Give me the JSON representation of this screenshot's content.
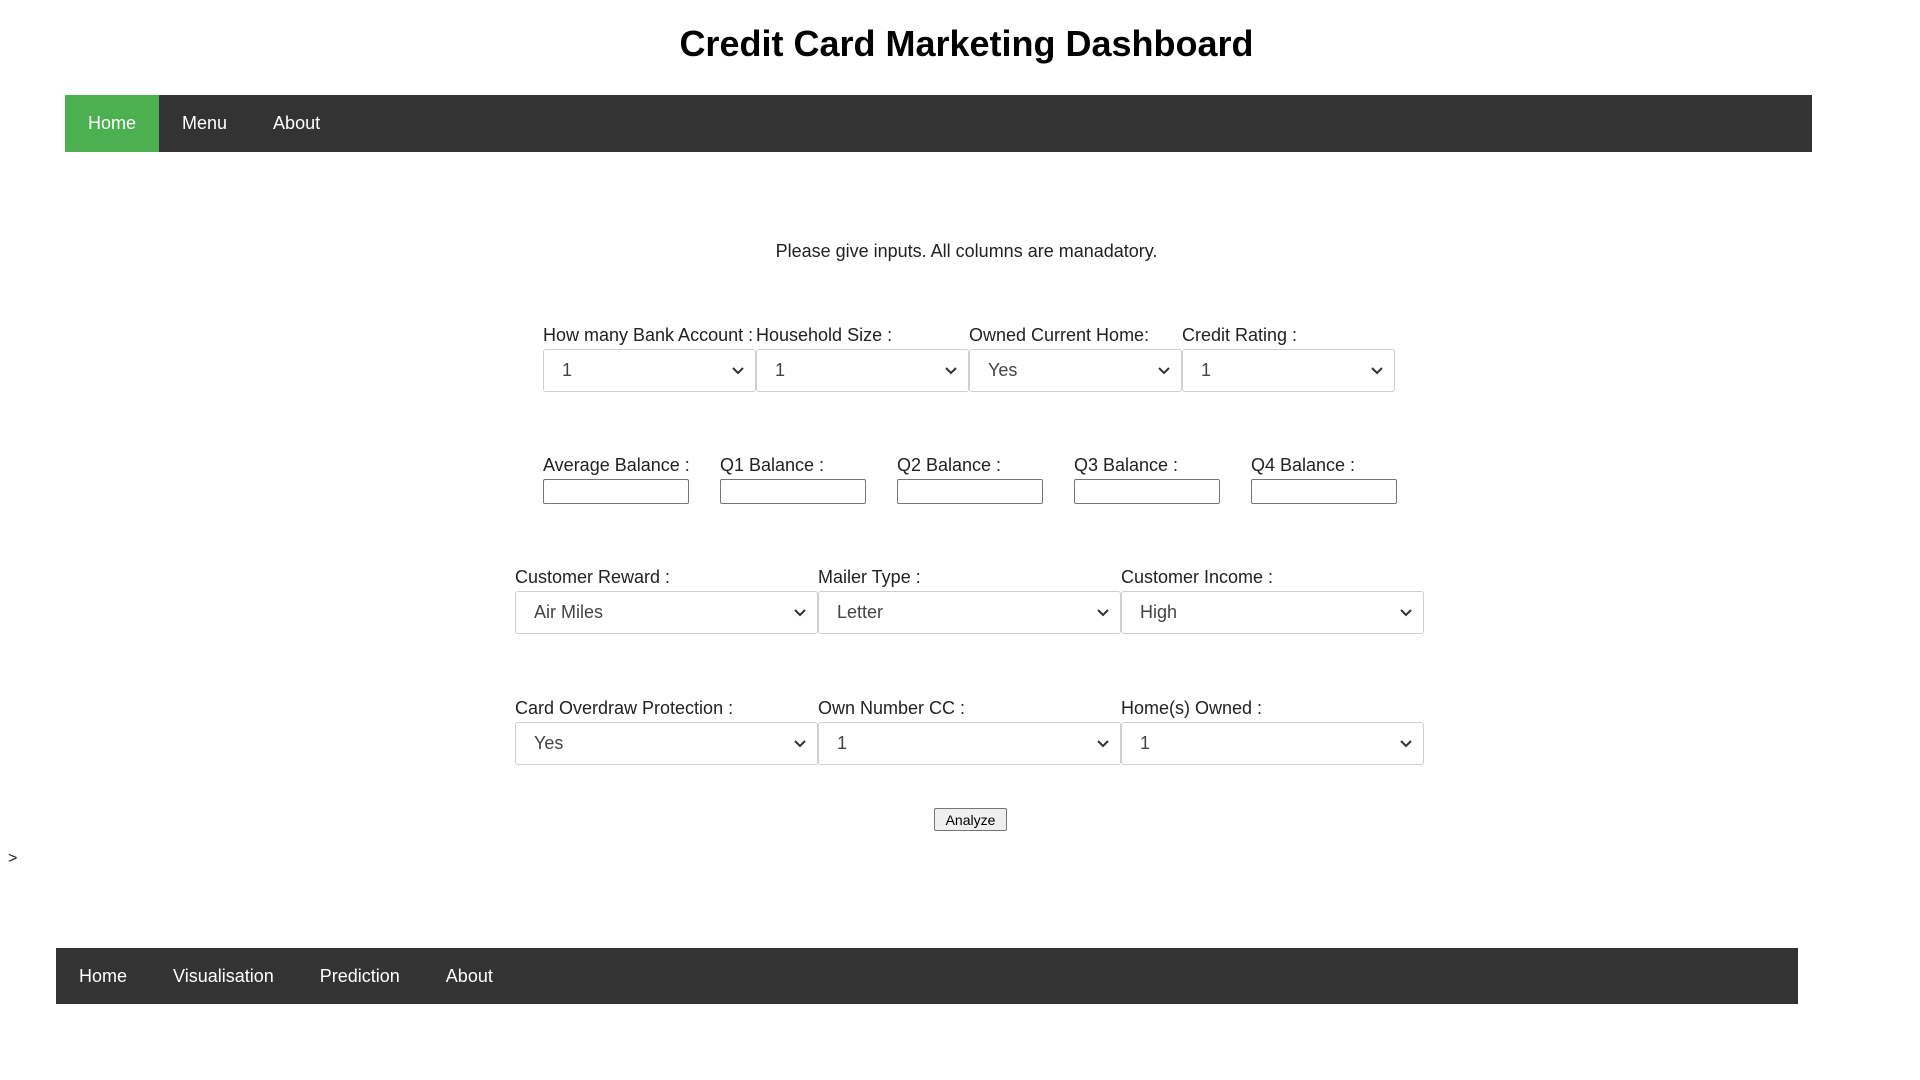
{
  "header": {
    "title": "Credit Card Marketing Dashboard"
  },
  "top_nav": {
    "items": [
      {
        "label": "Home",
        "active": true
      },
      {
        "label": "Menu"
      },
      {
        "label": "About"
      }
    ]
  },
  "intro": "Please give inputs. All columns are manadatory.",
  "row1": [
    {
      "label": "How many Bank Account :",
      "value": "1"
    },
    {
      "label": "Household Size :",
      "value": "1"
    },
    {
      "label": "Owned Current Home:",
      "value": "Yes"
    },
    {
      "label": "Credit Rating :",
      "value": "1"
    }
  ],
  "row2": [
    {
      "label": "Average Balance :",
      "value": ""
    },
    {
      "label": "Q1 Balance :",
      "value": ""
    },
    {
      "label": "Q2 Balance :",
      "value": ""
    },
    {
      "label": "Q3 Balance :",
      "value": ""
    },
    {
      "label": "Q4 Balance :",
      "value": ""
    }
  ],
  "row3": [
    {
      "label": "Customer Reward :",
      "value": "Air Miles"
    },
    {
      "label": "Mailer Type :",
      "value": "Letter"
    },
    {
      "label": "Customer Income :",
      "value": "High"
    }
  ],
  "row4": [
    {
      "label": "Card Overdraw Protection :",
      "value": "Yes"
    },
    {
      "label": "Own Number CC :",
      "value": "1"
    },
    {
      "label": "Home(s) Owned :",
      "value": "1"
    }
  ],
  "analyze_label": "Analyze",
  "stray_text": ">",
  "footer_nav": {
    "items": [
      {
        "label": "Home"
      },
      {
        "label": "Visualisation"
      },
      {
        "label": "Prediction"
      },
      {
        "label": "About"
      }
    ]
  },
  "colors": {
    "nav_bg": "#333333",
    "active": "#4caf50"
  },
  "icons": {
    "select_arrow": "chevron-down-icon"
  }
}
